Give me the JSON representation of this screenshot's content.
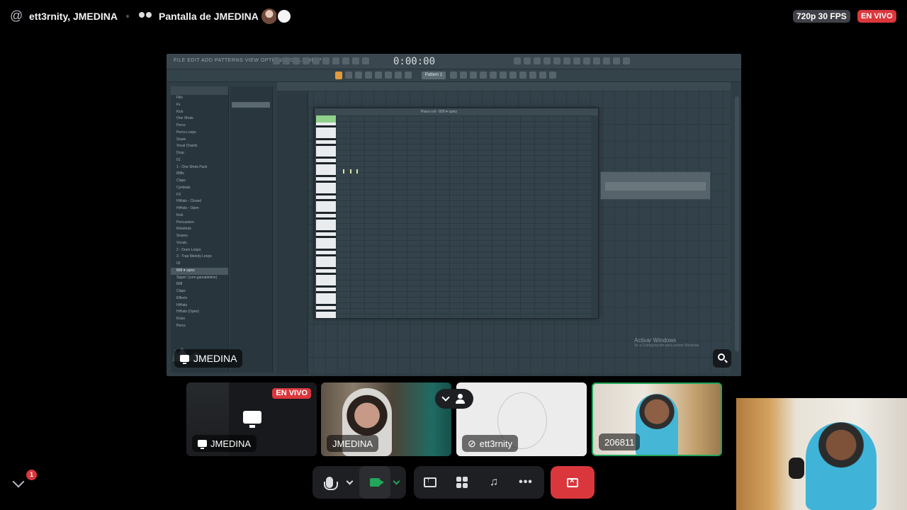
{
  "header": {
    "channel_name": "ett3rnity, JMEDINA",
    "stream_title": "Pantalla de JMEDINA",
    "quality_badge": "720p 30 FPS",
    "live_badge": "EN VIVO"
  },
  "main_stream": {
    "label": "JMEDINA",
    "app": {
      "time_display": "0:00:00",
      "pattern_label": "Pattern 1",
      "piano_roll_title": "Piano roll - 808 ♥ spinz",
      "browser_items": [
        "Fills",
        "Fx",
        "Kick",
        "One Shots",
        "Percs",
        "Percs Loops",
        "Snare",
        "Vocal Chants",
        "Drop",
        "01",
        "1 - One Shots Pack",
        "808s",
        "Claps",
        "Cymbals",
        "FX",
        "HiHats - Closed",
        "HiHats - Open",
        "Kick",
        "Percussion",
        "Rimshots",
        "Snares",
        "Vocals",
        "2 - Drum Loops",
        "3 - Trap Melody Loops",
        "02",
        "808 ♥ spinz",
        "Sippin' (com.gamaldeline)",
        "808",
        "Claps",
        "Effects",
        "HiHats",
        "HiHats (Open)",
        "Kicks",
        "Percs"
      ],
      "browser_selected": "808 ♥ spinz",
      "watermark_title": "Activar Windows",
      "watermark_sub": "Ve a Configuración para activar Windows."
    }
  },
  "participants": [
    {
      "name": "JMEDINA",
      "live_badge": "EN VIVO"
    },
    {
      "name": "JMEDINA"
    },
    {
      "name": "ett3rnity"
    },
    {
      "name": "206811"
    }
  ],
  "notifications": {
    "count": "1"
  },
  "icons": {
    "mic": "microphone-icon",
    "camera": "camera-icon",
    "share": "screen-share-icon",
    "activities": "activities-icon",
    "soundboard": "soundboard-icon",
    "more": "more-icon",
    "leave": "leave-call-icon"
  },
  "colors": {
    "live_red": "#da373c",
    "speaking_green": "#23a55a",
    "control_bg": "#1e1f22"
  }
}
